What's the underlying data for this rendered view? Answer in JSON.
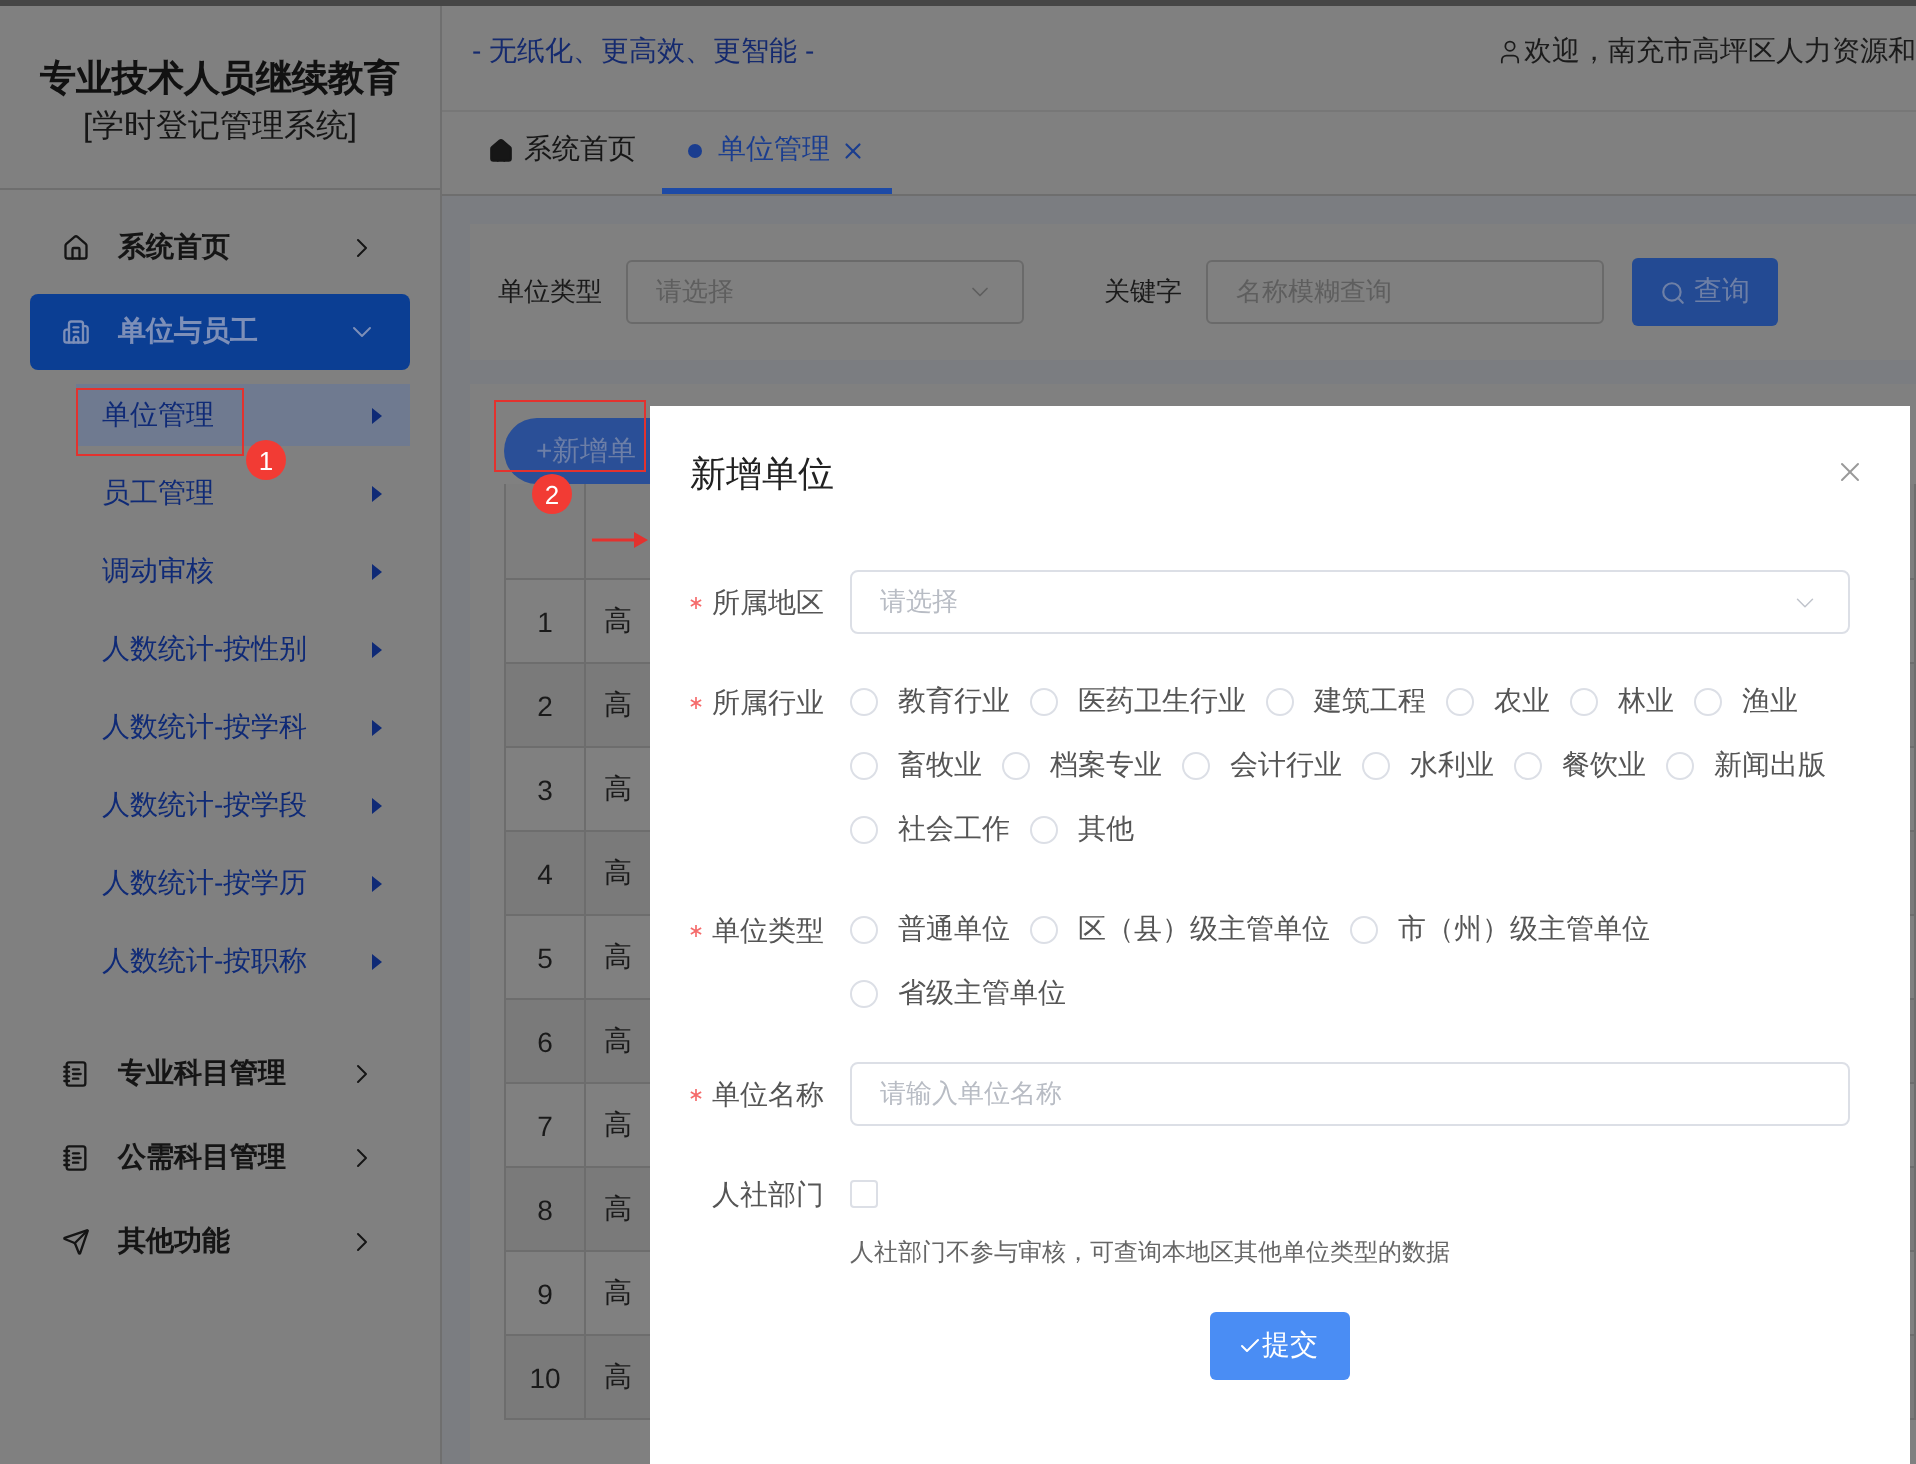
{
  "sidebar": {
    "title": "专业技术人员继续教育",
    "subtitle": "[学时登记管理系统]",
    "menu": [
      {
        "label": "系统首页",
        "selected": false,
        "expanded": false
      },
      {
        "label": "单位与员工",
        "selected": true,
        "expanded": true,
        "children": [
          {
            "label": "单位管理",
            "selected": true
          },
          {
            "label": "员工管理",
            "selected": false
          },
          {
            "label": "调动审核",
            "selected": false
          },
          {
            "label": "人数统计-按性别",
            "selected": false
          },
          {
            "label": "人数统计-按学科",
            "selected": false
          },
          {
            "label": "人数统计-按学段",
            "selected": false
          },
          {
            "label": "人数统计-按学历",
            "selected": false
          },
          {
            "label": "人数统计-按职称",
            "selected": false
          }
        ]
      },
      {
        "label": "专业科目管理",
        "selected": false,
        "expanded": false
      },
      {
        "label": "公需科目管理",
        "selected": false,
        "expanded": false
      },
      {
        "label": "其他功能",
        "selected": false,
        "expanded": false
      }
    ]
  },
  "header": {
    "slogan": "- 无纸化、更高效、更智能 -",
    "welcome": "欢迎，南充市高坪区人力资源和"
  },
  "tabs": [
    {
      "label": "系统首页",
      "selected": false
    },
    {
      "label": "单位管理",
      "selected": true
    }
  ],
  "filter": {
    "fields": [
      {
        "kind": "select",
        "label": "单位类型",
        "placeholder": "请选择"
      },
      {
        "kind": "input",
        "label": "关键字",
        "placeholder": "名称模糊查询"
      }
    ],
    "button": "查询"
  },
  "table": {
    "add_button": "+新增单",
    "rows": [
      {
        "index": "1",
        "column_2": "高"
      },
      {
        "index": "2",
        "column_2": "高"
      },
      {
        "index": "3",
        "column_2": "高"
      },
      {
        "index": "4",
        "column_2": "高"
      },
      {
        "index": "5",
        "column_2": "高"
      },
      {
        "index": "6",
        "column_2": "高"
      },
      {
        "index": "7",
        "column_2": "高"
      },
      {
        "index": "8",
        "column_2": "高"
      },
      {
        "index": "9",
        "column_2": "高"
      },
      {
        "index": "10",
        "column_2": "高"
      }
    ]
  },
  "dialog": {
    "title": "新增单位",
    "fields": [
      {
        "kind": "select",
        "label": "所属地区",
        "required": true,
        "placeholder": "请选择"
      },
      {
        "kind": "radio",
        "label": "所属行业",
        "required": true,
        "options": [
          {
            "label": "教育行业",
            "selected": false
          },
          {
            "label": "医药卫生行业",
            "selected": false
          },
          {
            "label": "建筑工程",
            "selected": false
          },
          {
            "label": "农业",
            "selected": false
          },
          {
            "label": "林业",
            "selected": false
          },
          {
            "label": "渔业",
            "selected": false
          },
          {
            "label": "畜牧业",
            "selected": false
          },
          {
            "label": "档案专业",
            "selected": false
          },
          {
            "label": "会计行业",
            "selected": false
          },
          {
            "label": "水利业",
            "selected": false
          },
          {
            "label": "餐饮业",
            "selected": false
          },
          {
            "label": "新闻出版",
            "selected": false
          },
          {
            "label": "社会工作",
            "selected": false
          },
          {
            "label": "其他",
            "selected": false
          }
        ]
      },
      {
        "kind": "radio",
        "label": "单位类型",
        "required": true,
        "options": [
          {
            "label": "普通单位",
            "selected": false
          },
          {
            "label": "区（县）级主管单位",
            "selected": false
          },
          {
            "label": "市（州）级主管单位",
            "selected": false
          },
          {
            "label": "省级主管单位",
            "selected": false
          }
        ]
      },
      {
        "kind": "input",
        "label": "单位名称",
        "required": true,
        "placeholder": "请输入单位名称"
      },
      {
        "kind": "checkbox",
        "label": "人社部门",
        "required": false,
        "checked": false,
        "hint": "人社部门不参与审核，可查询本地区其他单位类型的数据"
      }
    ],
    "submit": "提交"
  },
  "annotations": [
    {
      "label": "1"
    },
    {
      "label": "2"
    }
  ]
}
